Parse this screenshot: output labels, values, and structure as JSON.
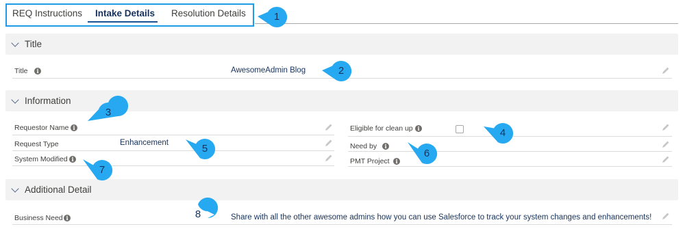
{
  "tabs": [
    {
      "label": "REQ Instructions",
      "active": false
    },
    {
      "label": "Intake Details",
      "active": true
    },
    {
      "label": "Resolution Details",
      "active": false
    }
  ],
  "sections": {
    "title": {
      "header": "Title",
      "fields": {
        "title": {
          "label": "Title",
          "value": "AwesomeAdmin Blog"
        }
      }
    },
    "information": {
      "header": "Information",
      "fields": {
        "requestor_name": {
          "label": "Requestor Name",
          "value": ""
        },
        "request_type": {
          "label": "Request Type",
          "value": "Enhancement"
        },
        "system_modified": {
          "label": "System Modified",
          "value": ""
        },
        "eligible_for_clean_up": {
          "label": "Eligible for clean up",
          "checked": false
        },
        "need_by": {
          "label": "Need by",
          "value": ""
        },
        "pmt_project": {
          "label": "PMT Project",
          "value": ""
        }
      }
    },
    "additional_detail": {
      "header": "Additional Detail",
      "fields": {
        "business_need": {
          "label": "Business Need",
          "value": "Share with all the other awesome admins how you can use Salesforce to track your system changes and enhancements!"
        }
      }
    }
  },
  "callouts": [
    "1",
    "2",
    "3",
    "4",
    "5",
    "6",
    "7",
    "8"
  ],
  "icons": {
    "info": "info-icon",
    "edit": "pencil-icon",
    "collapse": "chevron-down-icon"
  },
  "colors": {
    "callout_fill": "#27a9f1",
    "tab_outline": "#1d9be6",
    "section_bg": "#f3f2f2"
  }
}
